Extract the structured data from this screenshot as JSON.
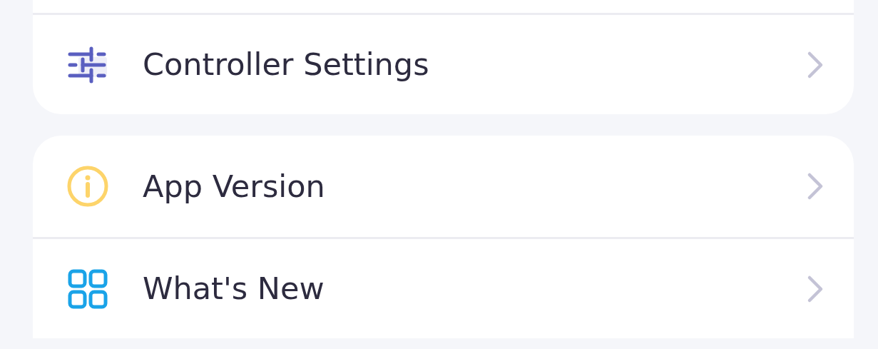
{
  "sections": [
    {
      "items": [
        {
          "label": "Controller Settings",
          "kind": "sliders"
        }
      ]
    },
    {
      "items": [
        {
          "label": "App Version",
          "kind": "info"
        },
        {
          "label": "What's New",
          "kind": "tiles"
        }
      ]
    }
  ]
}
